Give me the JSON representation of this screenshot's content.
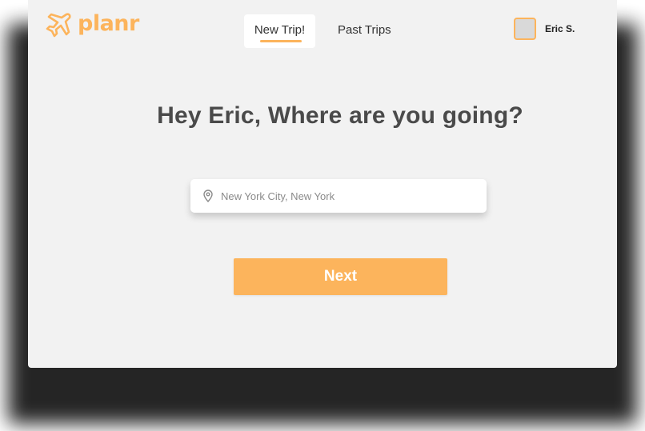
{
  "brand": {
    "name": "planr",
    "accent_color": "#fcb45c",
    "logo_icon": "airplane-icon"
  },
  "nav": {
    "tabs": [
      {
        "label": "New Trip!",
        "active": true
      },
      {
        "label": "Past Trips",
        "active": false
      }
    ]
  },
  "user": {
    "name": "Eric S."
  },
  "main": {
    "headline": "Hey Eric, Where are you going?",
    "search": {
      "placeholder": "New York City, New York",
      "value": "",
      "icon": "map-pin-icon"
    },
    "next_label": "Next"
  }
}
